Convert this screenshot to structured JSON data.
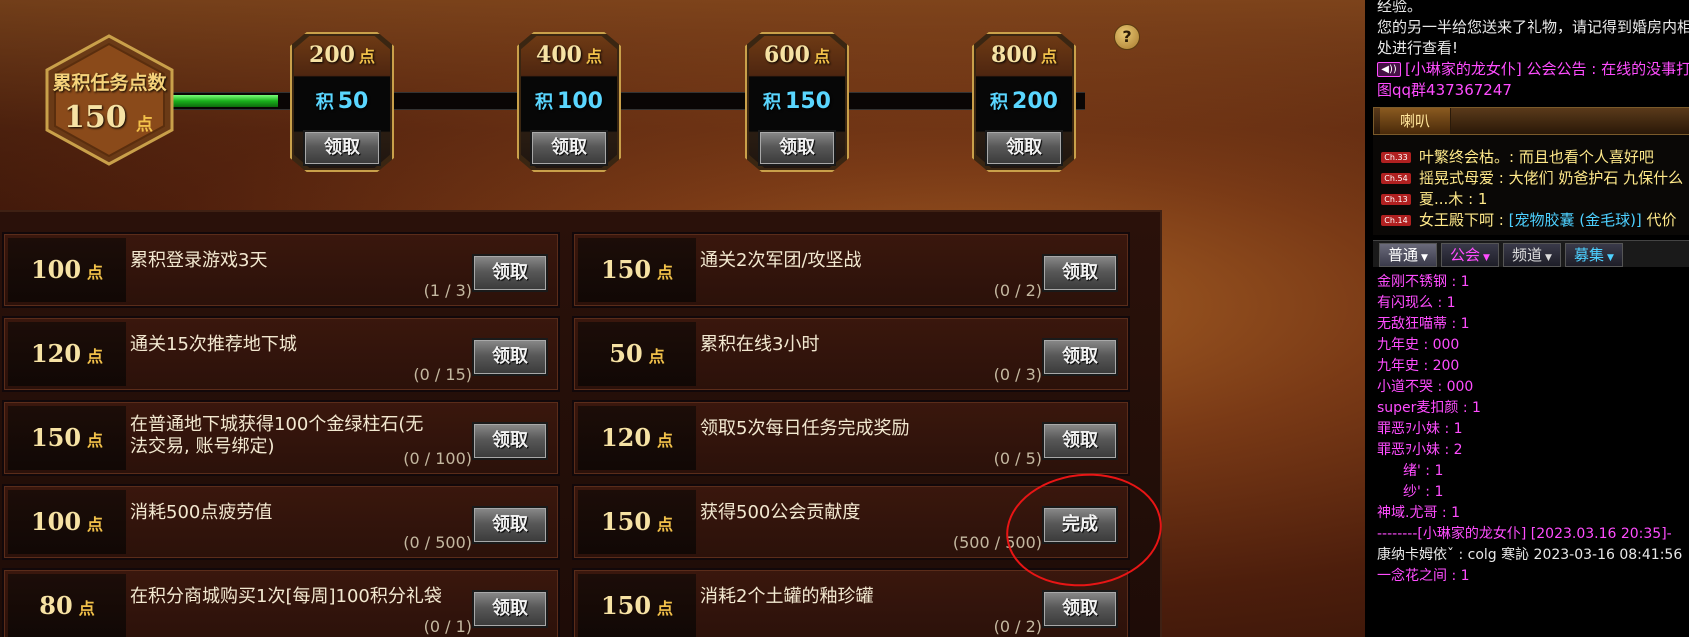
{
  "header": {
    "total_label": "累积任务点数",
    "total_value": "150",
    "unit": "点",
    "help_icon": "?",
    "progress_fraction": 0.123
  },
  "milestones": [
    {
      "points": "200",
      "reward_prefix": "积",
      "reward": "50",
      "button": "领取"
    },
    {
      "points": "400",
      "reward_prefix": "积",
      "reward": "100",
      "button": "领取"
    },
    {
      "points": "600",
      "reward_prefix": "积",
      "reward": "150",
      "button": "领取"
    },
    {
      "points": "800",
      "reward_prefix": "积",
      "reward": "200",
      "button": "领取"
    }
  ],
  "quests": [
    {
      "points": "100",
      "text": "累积登录游戏3天",
      "progress": "(1 / 3)",
      "button": "领取"
    },
    {
      "points": "150",
      "text": "通关2次军团/攻坚战",
      "progress": "(0 / 2)",
      "button": "领取"
    },
    {
      "points": "120",
      "text": "通关15次推荐地下城",
      "progress": "(0 / 15)",
      "button": "领取"
    },
    {
      "points": "50",
      "text": "累积在线3小时",
      "progress": "(0 / 3)",
      "button": "领取"
    },
    {
      "points": "150",
      "text": "在普通地下城获得100个金绿柱石(无法交易, 账号绑定)",
      "progress": "(0 / 100)",
      "button": "领取"
    },
    {
      "points": "120",
      "text": "领取5次每日任务完成奖励",
      "progress": "(0 / 5)",
      "button": "领取"
    },
    {
      "points": "100",
      "text": "消耗500点疲劳值",
      "progress": "(0 / 500)",
      "button": "领取"
    },
    {
      "points": "150",
      "text": "获得500公会贡献度",
      "progress": "(500 / 500)",
      "button": "完成"
    },
    {
      "points": "80",
      "text": "在积分商城购买1次[每周]100积分礼袋",
      "progress": "(0 / 1)",
      "button": "领取"
    },
    {
      "points": "150",
      "text": "消耗2个土罐的釉珍罐",
      "progress": "(0 / 2)",
      "button": "领取"
    }
  ],
  "chat": {
    "system_lines": [
      "经验。",
      "您的另一半给您送来了礼物，请记得到婚房内相关",
      "处进行查看!",
      "[小琳家的龙女仆] 公会公告 : 在线的没事打",
      "图qq群437367247"
    ],
    "horn_tab": "喇叭",
    "horn_lines": [
      {
        "channel": "Ch.33",
        "text": "叶繁终会枯。: 而且也看个人喜好吧"
      },
      {
        "channel": "Ch.54",
        "text": "摇晃式母爱 : 大佬们   奶爸护石 九保什么"
      },
      {
        "channel": "Ch.13",
        "text": "夏...木 : 1"
      },
      {
        "channel": "Ch.14",
        "text": "女王殿下呵 : ",
        "item": "[宠物胶囊 (金毛球)]",
        "suffix": " 代价"
      }
    ],
    "channel_tabs": [
      "普通",
      "公会",
      "频道",
      "募集"
    ],
    "messages": [
      {
        "text": "金刚不锈钢 : 1",
        "color": "pink"
      },
      {
        "text": "有闪现么 : 1",
        "color": "pink"
      },
      {
        "text": "无敌狂喵蒂 : 1",
        "color": "pink"
      },
      {
        "text": "九年史 : 000",
        "color": "pink"
      },
      {
        "text": "九年史 : 200",
        "color": "pink"
      },
      {
        "text": "小道不哭 : 000",
        "color": "pink"
      },
      {
        "text": "super麦扣颜 : 1",
        "color": "pink"
      },
      {
        "text": "罪恶ｦ小妹 : 1",
        "color": "pink"
      },
      {
        "text": "罪恶ｦ小妹 : 2",
        "color": "pink"
      },
      {
        "text": "绪' : 1",
        "color": "pink",
        "indent": true
      },
      {
        "text": "纱' : 1",
        "color": "pink",
        "indent": true
      },
      {
        "text": "神域.尤哥 : 1",
        "color": "pink"
      },
      {
        "text": "--------[小琳家的龙女仆] [2023.03.16 20:35]-",
        "color": "pink"
      },
      {
        "text": "康纳卡姆依ˇ : colg 寒訫 2023-03-16 08:41:56",
        "color": "white"
      },
      {
        "text": "一念花之间 : 1",
        "color": "pink"
      }
    ]
  }
}
